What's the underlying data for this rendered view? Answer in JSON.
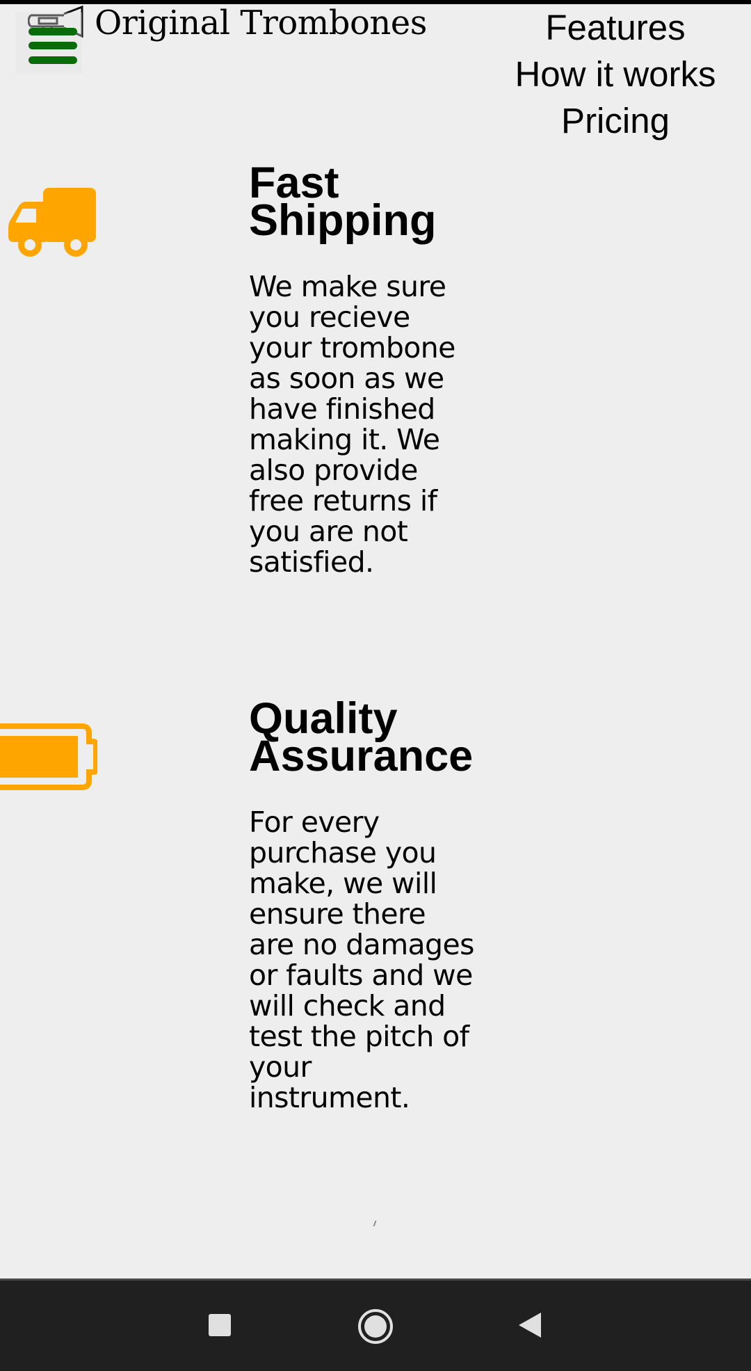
{
  "header": {
    "brand": "Original Trombones",
    "logo_icon": "trombone-icon",
    "menu_icon": "hamburger-menu-icon"
  },
  "nav": {
    "links": [
      "Features",
      "How it works",
      "Pricing"
    ]
  },
  "features": [
    {
      "icon": "truck-icon",
      "title": "Fast Shipping",
      "text": "We make sure you recieve your trombone as soon as we have finished making it. We also provide free returns if you are not satisfied."
    },
    {
      "icon": "battery-full-icon",
      "title": "Quality Assurance",
      "text": "For every purchase you make, we will ensure there are no damages or faults and we will check and test the pitch of your instrument."
    }
  ],
  "colors": {
    "accent": "#ffa500",
    "menu": "#0a6b0a",
    "background": "#eeeeee",
    "system_nav": "#202020"
  },
  "system_nav": {
    "buttons": [
      "recents-square-icon",
      "home-circle-icon",
      "back-triangle-icon"
    ]
  }
}
